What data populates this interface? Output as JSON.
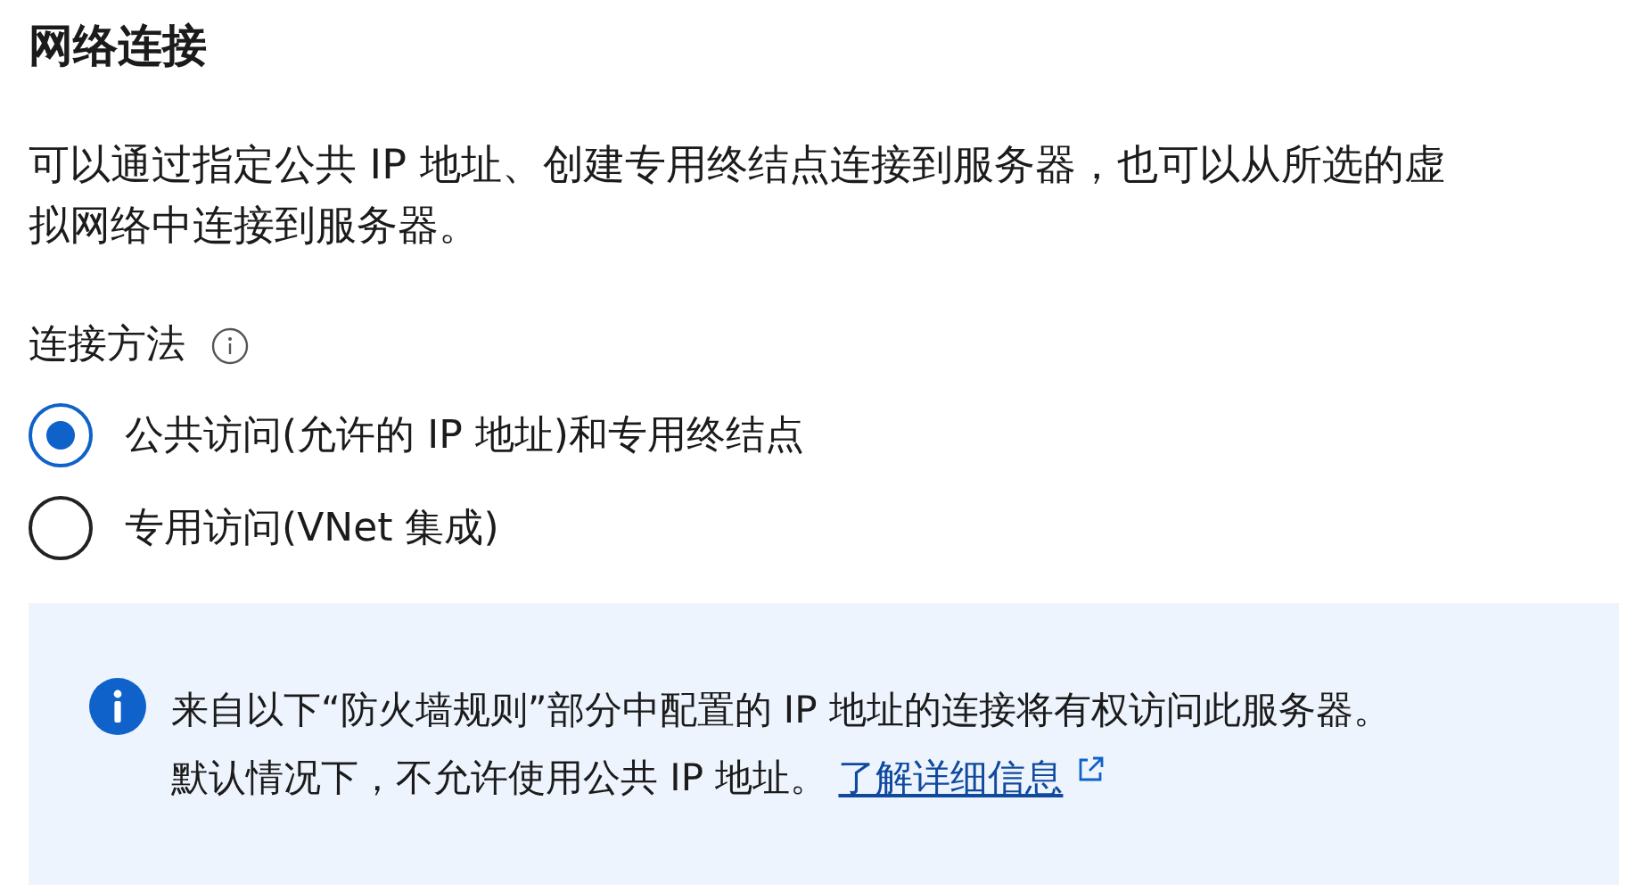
{
  "heading": "网络连接",
  "description": "可以通过指定公共 IP 地址、创建专用终结点连接到服务器，也可以从所选的虚拟网络中连接到服务器。",
  "connectivity": {
    "label": "连接方法",
    "options": [
      {
        "label": "公共访问(允许的 IP 地址)和专用终结点",
        "selected": true
      },
      {
        "label": "专用访问(VNet 集成)",
        "selected": false
      }
    ]
  },
  "info_box": {
    "text": "来自以下“防火墙规则”部分中配置的 IP 地址的连接将有权访问此服务器。默认情况下，不允许使用公共 IP 地址。",
    "link": "了解详细信息"
  }
}
